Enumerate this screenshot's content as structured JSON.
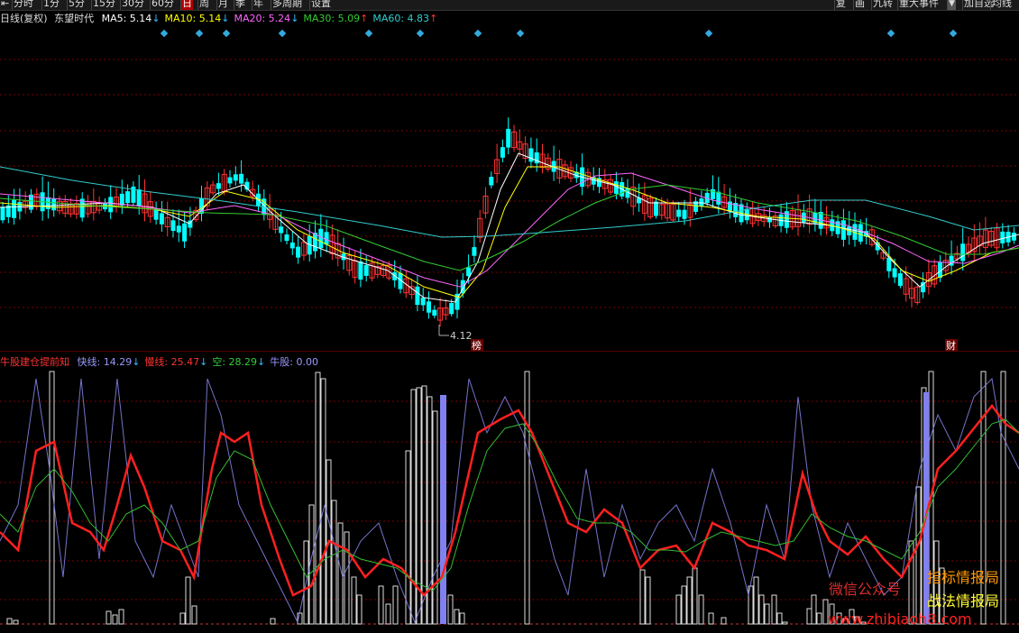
{
  "toolbar": {
    "left": [
      {
        "label": "⇤"
      },
      {
        "label": "分时"
      },
      {
        "label": "1分"
      },
      {
        "label": "5分"
      },
      {
        "label": "15分"
      },
      {
        "label": "30分"
      },
      {
        "label": "60分"
      },
      {
        "label": "日",
        "selected": true
      },
      {
        "label": "周"
      },
      {
        "label": "月"
      },
      {
        "label": "季"
      },
      {
        "label": "年"
      },
      {
        "label": "多周期"
      },
      {
        "label": "设置"
      }
    ],
    "right": [
      {
        "label": "复"
      },
      {
        "label": "画"
      },
      {
        "label": "九转"
      },
      {
        "label": "重大事件"
      },
      {
        "label": "▼"
      },
      {
        "label": "加自选"
      },
      {
        "label": "均线"
      }
    ]
  },
  "main_header": {
    "period": "日线(复权)",
    "stock": "东望时代",
    "ma": [
      {
        "label": "MA5: 5.14",
        "arrow": "↓",
        "color": "#ffffff",
        "arrow_color": "#33bbff"
      },
      {
        "label": "MA10: 5.14",
        "arrow": "↓",
        "color": "#ffff00",
        "arrow_color": "#33bbff"
      },
      {
        "label": "MA20: 5.24",
        "arrow": "↓",
        "color": "#ff66ff",
        "arrow_color": "#33bbff"
      },
      {
        "label": "MA30: 5.09",
        "arrow": "↑",
        "color": "#33cc33",
        "arrow_color": "#ff3333"
      },
      {
        "label": "MA60: 4.83",
        "arrow": "↑",
        "color": "#33cccc",
        "arrow_color": "#ff3333"
      }
    ]
  },
  "annotations": {
    "low_price": "4.12",
    "mark1": "榜",
    "mark2": "财"
  },
  "indicator_header": {
    "name": "牛股建仓提前知",
    "items": [
      {
        "label": "快线: 14.29",
        "arrow": "↓",
        "color": "#9999ff",
        "arrow_color": "#33bbff"
      },
      {
        "label": "慢线: 25.47",
        "arrow": "↓",
        "color": "#ff3333",
        "arrow_color": "#33bbff"
      },
      {
        "label": "空: 28.29",
        "arrow": "↓",
        "color": "#33cc33",
        "arrow_color": "#33bbff"
      },
      {
        "label": "牛股: 0.00",
        "arrow": "",
        "color": "#9999ff",
        "arrow_color": "#33bbff"
      }
    ]
  },
  "watermark": {
    "w1": "微信公众号",
    "w2": "指标情报局",
    "w3": "战法情报局",
    "w4": "www.zhibiaoh8.com"
  },
  "colors": {
    "up": "#ff3232",
    "down": "#00ffff",
    "grid": "#7a0000",
    "ma5": "#ffffff",
    "ma10": "#ffff00",
    "ma20": "#ff66ff",
    "ma30": "#33cc33",
    "ma60": "#33cccc"
  }
}
